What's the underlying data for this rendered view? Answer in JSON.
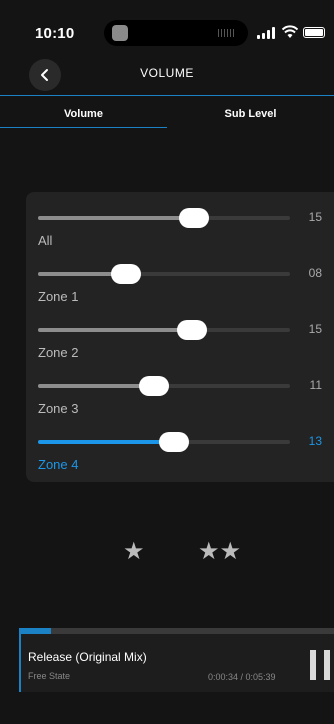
{
  "status": {
    "time": "10:10"
  },
  "header": {
    "title": "VOLUME"
  },
  "tabs": [
    {
      "label": "Volume",
      "active": true
    },
    {
      "label": "Sub Level",
      "active": false
    }
  ],
  "zones": [
    {
      "label": "All",
      "value": "15",
      "level": 0.62,
      "active": false
    },
    {
      "label": "Zone 1",
      "value": "08",
      "level": 0.35,
      "active": false
    },
    {
      "label": "Zone 2",
      "value": "15",
      "level": 0.61,
      "active": false
    },
    {
      "label": "Zone 3",
      "value": "11",
      "level": 0.46,
      "active": false
    },
    {
      "label": "Zone 4",
      "value": "13",
      "level": 0.54,
      "active": true
    }
  ],
  "favorites": {
    "single": "★",
    "double": "★★"
  },
  "player": {
    "title": "Release (Original Mix)",
    "artist": "Free State",
    "time": "0:00:34 / 0:05:39",
    "progress": 0.1
  },
  "colors": {
    "accent": "#1b96e8",
    "background": "#141414",
    "panel": "#232323"
  }
}
